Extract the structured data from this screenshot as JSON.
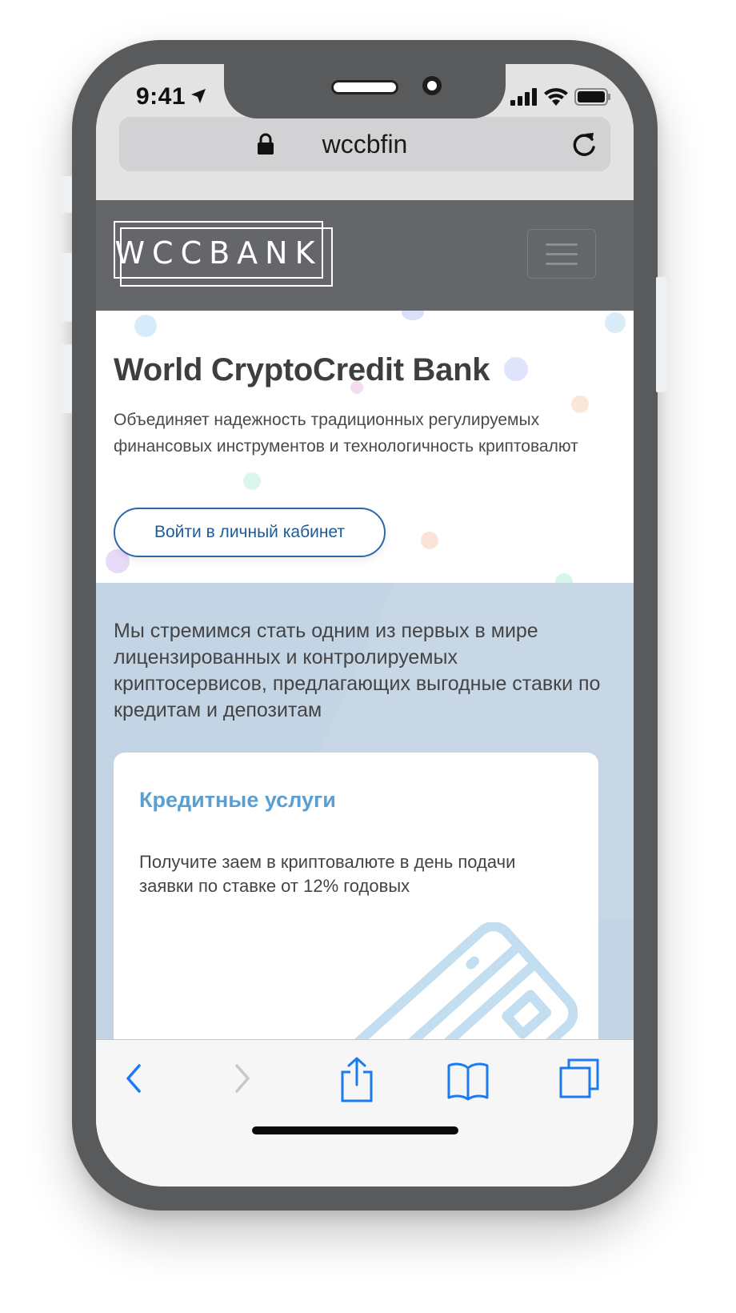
{
  "status_bar": {
    "time": "9:41"
  },
  "browser": {
    "url": "wccbfin"
  },
  "site": {
    "logo_text": "WCCBANK",
    "hero": {
      "title": "World CryptoCredit Bank",
      "subtitle": "Объединяет надежность традиционных регулируемых финансовых инструментов и технологичность криптовалют",
      "cta_label": "Войти в личный кабинет"
    },
    "mission": "Мы стремимся стать одним из первых в мире лицензированных и контролируемых криптосервисов, предлагающих выгодные ставки по кредитам и депозитам",
    "card": {
      "title": "Кредитные услуги",
      "text": "Получите заем в криптовалюте в день подачи заявки по ставке от 12% годовых",
      "icon": "credit-card-icon"
    }
  },
  "colors": {
    "header_bg": "#64666a",
    "accent": "#1e5a98",
    "card_title": "#5a9fd2",
    "section_bg": "#c3d4e5",
    "toolbar_icon": "#1a7cf0"
  },
  "toolbar": {
    "icons": [
      "back-icon",
      "forward-icon",
      "share-icon",
      "bookmarks-icon",
      "tabs-icon"
    ]
  }
}
